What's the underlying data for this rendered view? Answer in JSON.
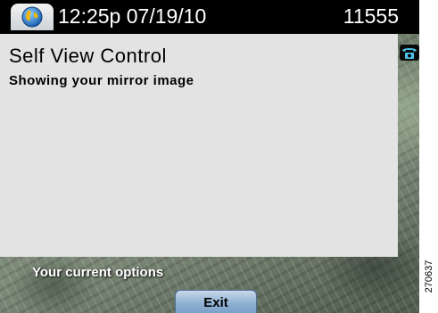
{
  "status_bar": {
    "datetime": "12:25p 07/19/10",
    "extension": "11555",
    "line_icon": "globe-icon"
  },
  "panel": {
    "title": "Self View Control",
    "subtitle": "Showing your mirror image"
  },
  "side_icon": "phone-handset-icon",
  "softkeys": {
    "options_label": "Your current options",
    "exit_label": "Exit"
  },
  "figure_id": "270637",
  "colors": {
    "panel_bg": "#e3e3e3",
    "topbar_bg": "#000000",
    "softkey_bg": "#8fb0d2"
  }
}
